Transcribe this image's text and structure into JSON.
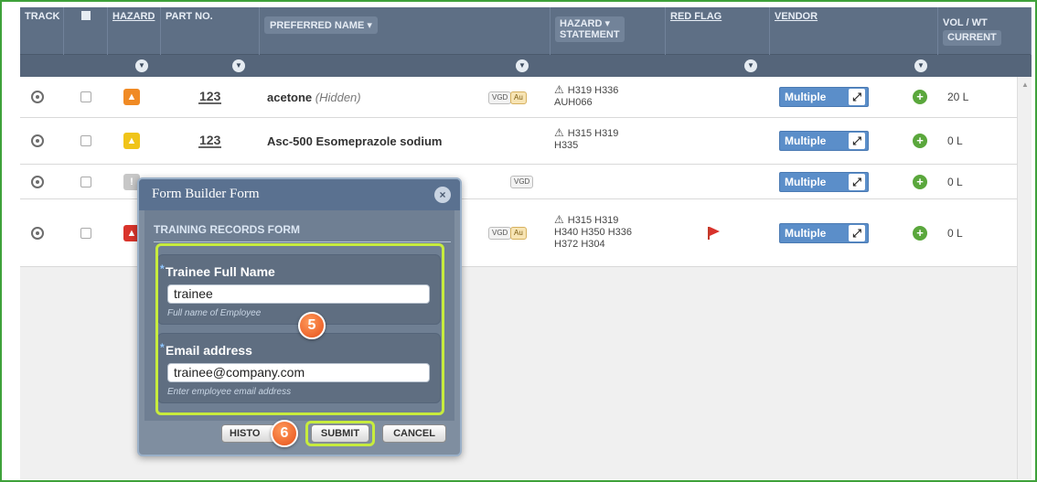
{
  "columns": {
    "track": "TRACK",
    "hazard": "HAZARD",
    "part_no": "PART NO.",
    "preferred_name": "PREFERRED NAME",
    "hazard_statement_1": "HAZARD",
    "hazard_statement_2": "STATEMENT",
    "red_flag": "RED FLAG",
    "vendor": "VENDOR",
    "vol_wt": "VOL / WT",
    "current": "CURRENT"
  },
  "rows": [
    {
      "hazard_color": "#f08a24",
      "part_no": "123",
      "name": "acetone",
      "name_note": "(Hidden)",
      "tags": [
        "VGD",
        "Au"
      ],
      "hazard_statement": [
        "H319 H336",
        "AUH066"
      ],
      "vendor": "Multiple",
      "vol": "20 L"
    },
    {
      "hazard_color": "#f0c419",
      "part_no": "123",
      "name": "Asc-500 Esomeprazole sodium",
      "name_note": "",
      "tags": [],
      "hazard_statement": [
        "H315 H319",
        "H335"
      ],
      "vendor": "Multiple",
      "vol": "0 L"
    },
    {
      "hazard_color": "#c7c7c7",
      "part_no": "",
      "name": "",
      "name_note": "",
      "tags": [
        "VGD"
      ],
      "hazard_statement": [],
      "vendor": "Multiple",
      "vol": "0 L"
    },
    {
      "hazard_color": "#d9342b",
      "part_no": "",
      "name": "",
      "name_note": "",
      "tags": [
        "VGD",
        "Au"
      ],
      "hazard_statement": [
        "H315 H319",
        "H340 H350 H336",
        "H372 H304"
      ],
      "red_flag": true,
      "vendor": "Multiple",
      "vol": "0 L"
    }
  ],
  "modal": {
    "title": "Form Builder Form",
    "form_title": "TRAINING RECORDS FORM",
    "fields": [
      {
        "label": "Trainee Full Name",
        "value": "trainee",
        "hint": "Full name of Employee"
      },
      {
        "label": "Email address",
        "value": "trainee@company.com",
        "hint": "Enter employee email address"
      }
    ],
    "buttons": {
      "history": "HISTO",
      "submit": "SUBMIT",
      "cancel": "CANCEL"
    }
  },
  "callouts": {
    "step5": "5",
    "step6": "6"
  },
  "colors": {
    "header": "#5e6f85",
    "highlight": "#c7ec3d",
    "vendor": "#5b8ec9",
    "badge": "#e6501a"
  }
}
